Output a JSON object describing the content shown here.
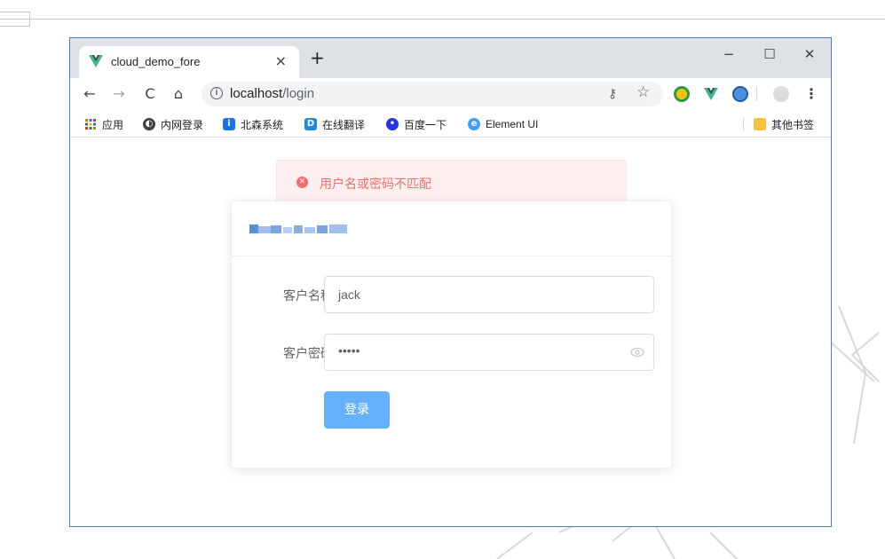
{
  "browser": {
    "tab_title": "cloud_demo_fore",
    "tab_close": "×",
    "new_tab": "+",
    "window_controls": {
      "minimize": "−",
      "maximize": "☐",
      "close": "✕"
    },
    "nav": {
      "back": "←",
      "forward": "→",
      "reload": "C",
      "home": "⌂"
    },
    "url_host": "localhost",
    "url_path": "/login",
    "omnibox_icons": {
      "key": "⚷",
      "star": "☆"
    },
    "menu": "⋮"
  },
  "bookmarks": [
    {
      "label": "应用",
      "icon": "apps-grid-icon",
      "color": "#e8710a"
    },
    {
      "label": "内网登录",
      "icon": "globe-icon",
      "color": "#3c4043"
    },
    {
      "label": "北森系统",
      "icon": "info-square-icon",
      "color": "#1a73e8"
    },
    {
      "label": "在线翻译",
      "icon": "translate-icon",
      "color": "#1e88e5"
    },
    {
      "label": "百度一下",
      "icon": "baidu-paw-icon",
      "color": "#2932e1"
    },
    {
      "label": "Element UI",
      "icon": "element-icon",
      "color": "#409eff"
    }
  ],
  "other_bookmarks": "其他书签",
  "alert": {
    "message": "用户名或密码不匹配",
    "color": "#f56c6c"
  },
  "form": {
    "username_label": "客户名称",
    "username_value": "jack",
    "password_label": "客户密码",
    "password_value": "•••••",
    "submit_label": "登录",
    "submit_color": "#66b1ff"
  }
}
